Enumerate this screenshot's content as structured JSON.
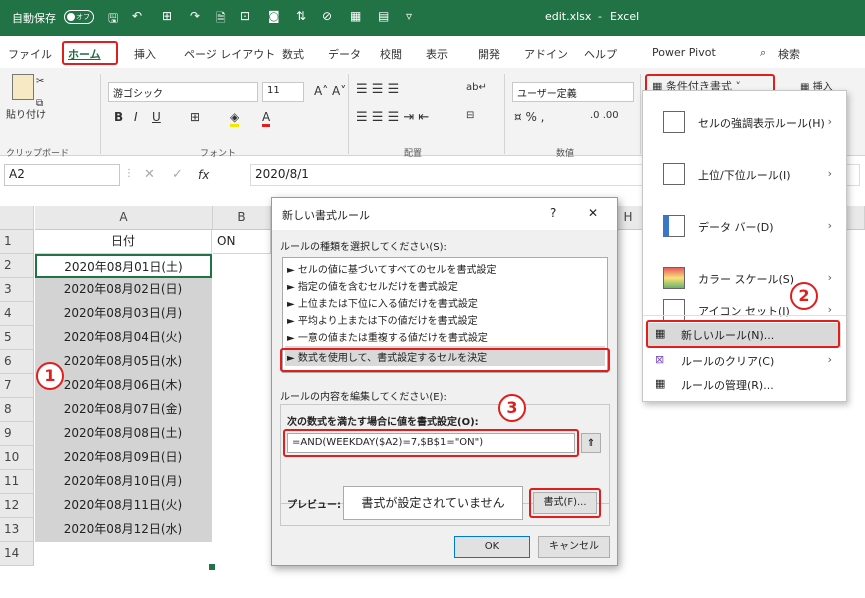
{
  "titlebar": {
    "autosave": "自動保存",
    "toggle": "オフ",
    "filename": "edit.xlsx",
    "sep": "-",
    "app": "Excel"
  },
  "tabs": [
    "ファイル",
    "ホーム",
    "挿入",
    "ページ レイアウト",
    "数式",
    "データ",
    "校閲",
    "表示",
    "開発",
    "アドイン",
    "ヘルプ",
    "Power Pivot"
  ],
  "search": "検索",
  "ribbon": {
    "paste": "貼り付け",
    "clipboard": "クリップボード",
    "font_name": "游ゴシック",
    "font_size": "11",
    "font_group": "フォント",
    "align_group": "配置",
    "number_format": "ユーザー定義",
    "number_group": "数値",
    "cond_format": "条件付き書式",
    "insert": "挿入",
    "bold": "B",
    "italic": "I",
    "underline": "U"
  },
  "formula": {
    "namebox": "A2",
    "fx": "fx",
    "value": "2020/8/1"
  },
  "columns": [
    "A",
    "B",
    "H"
  ],
  "rows": [
    "1",
    "2",
    "3",
    "4",
    "5",
    "6",
    "7",
    "8",
    "9",
    "10",
    "11",
    "12",
    "13",
    "14"
  ],
  "cells": {
    "a1": "日付",
    "b1": "ON",
    "dates": [
      "2020年08月01日(土)",
      "2020年08月02日(日)",
      "2020年08月03日(月)",
      "2020年08月04日(火)",
      "2020年08月05日(水)",
      "2020年08月06日(木)",
      "2020年08月07日(金)",
      "2020年08月08日(土)",
      "2020年08月09日(日)",
      "2020年08月10日(月)",
      "2020年08月11日(火)",
      "2020年08月12日(水)"
    ]
  },
  "dialog": {
    "title": "新しい書式ルール",
    "help": "?",
    "close": "✕",
    "rule_type_label": "ルールの種類を選択してください(S):",
    "rules": [
      "► セルの値に基づいてすべてのセルを書式設定",
      "► 指定の値を含むセルだけを書式設定",
      "► 上位または下位に入る値だけを書式設定",
      "► 平均より上または下の値だけを書式設定",
      "► 一意の値または重複する値だけを書式設定",
      "► 数式を使用して、書式設定するセルを決定"
    ],
    "edit_label": "ルールの内容を編集してください(E):",
    "formula_label": "次の数式を満たす場合に値を書式設定(O):",
    "formula": "=AND(WEEKDAY($A2)=7,$B$1=\"ON\")",
    "preview_label": "プレビュー:",
    "preview_text": "書式が設定されていません",
    "format_btn": "書式(F)...",
    "ok": "OK",
    "cancel": "キャンセル"
  },
  "menu": {
    "items": [
      "セルの強調表示ルール(H)",
      "上位/下位ルール(I)",
      "データ バー(D)",
      "カラー スケール(S)",
      "アイコン セット(I)"
    ],
    "new_rule": "新しいルール(N)...",
    "clear": "ルールのクリア(C)",
    "manage": "ルールの管理(R)..."
  },
  "badges": [
    "1",
    "2",
    "3"
  ],
  "colors": {
    "excel_green": "#217346",
    "highlight_red": "#e21d1d",
    "selected_fill": "#d3d3d3"
  }
}
